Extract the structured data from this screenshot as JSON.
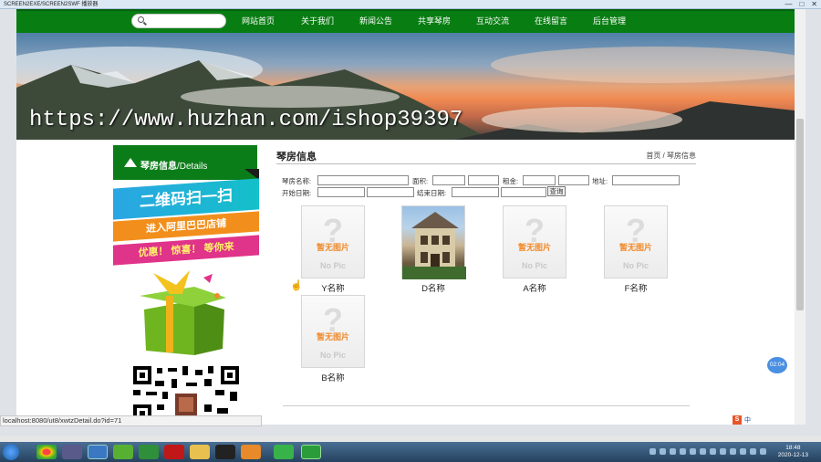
{
  "window": {
    "title": "SCREEN2EXE/SCREEN2SWF 播放器",
    "controls": [
      "—",
      "□",
      "✕"
    ]
  },
  "nav": {
    "search_placeholder": "",
    "items": [
      "网站首页",
      "关于我们",
      "新闻公告",
      "共享琴房",
      "互动交流",
      "在线留言",
      "后台管理"
    ]
  },
  "banner": {
    "watermark": "https://www.huzhan.com/ishop39397",
    "slides": 5,
    "active_slide": 1
  },
  "sidebar": {
    "header_cn": "琴房信息",
    "header_en": "/Details",
    "ad_line1": "二维码扫一扫",
    "ad_line2": "进入阿里巴巴店铺",
    "ad_line3": "优惠！ 惊喜！ 等你来"
  },
  "content": {
    "title": "琴房信息",
    "breadcrumb": "首页 / 琴房信息",
    "filters": {
      "name_label": "琴房名称:",
      "area_label": "面积:",
      "rent_label": "租金:",
      "address_label": "地址:",
      "start_label": "开始日期:",
      "end_label": "结束日期:",
      "query_button": "查询"
    },
    "placeholder_text": {
      "q": "?",
      "no_image": "暂无图片",
      "no_pic": "No Pic"
    },
    "items": [
      {
        "name": "Y名称",
        "has_photo": false
      },
      {
        "name": "D名称",
        "has_photo": true
      },
      {
        "name": "A名称",
        "has_photo": false
      },
      {
        "name": "F名称",
        "has_photo": false
      },
      {
        "name": "B名称",
        "has_photo": false
      }
    ]
  },
  "status_bar": {
    "url": "localhost:8080/ut8/xwtzDetail.do?id=71"
  },
  "overlay": {
    "time_badge": "02:04"
  },
  "ime": {
    "label": "中"
  },
  "taskbar": {
    "time": "18:48",
    "date": "2020-12-13"
  },
  "colors": {
    "nav_green": "#087d12",
    "sidebar_green": "#0b7d18",
    "accent_orange": "#f08a2a"
  }
}
